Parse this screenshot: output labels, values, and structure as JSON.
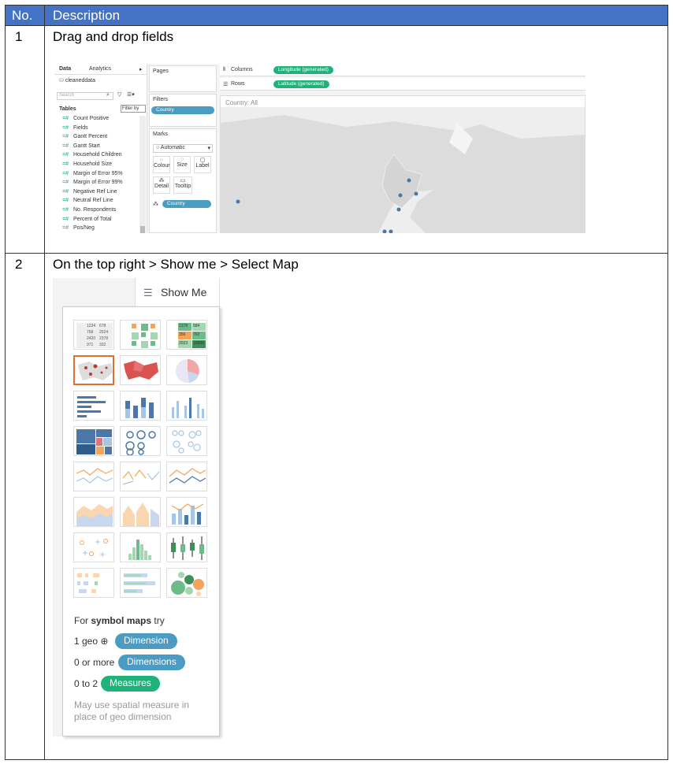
{
  "table": {
    "header_no": "No.",
    "header_desc": "Description",
    "rows": [
      {
        "no": "1",
        "desc": "Drag and drop fields"
      },
      {
        "no": "2",
        "desc": "On the top right > Show me > Select Map"
      }
    ]
  },
  "tableau": {
    "tab_data": "Data",
    "tab_analytics": "Analytics",
    "datasource": "cleaneddata",
    "search_placeholder": "Search",
    "filter_by": "Filter by",
    "tables_label": "Tables",
    "fields": [
      "Count Positive",
      "Fields",
      "Gantt Percent",
      "Gantt Start",
      "Household Children",
      "Household Size",
      "Margin of Error 95%",
      "Margin of Error 99%",
      "Negative Ref Line",
      "Neutral Ref Line",
      "No. Respondents",
      "Percent of Total",
      "Pos/Neg"
    ],
    "pages_label": "Pages",
    "filters_label": "Filters",
    "filter_pill": "Country",
    "marks_label": "Marks",
    "marks_type": "Automatic",
    "mark_colour": "Colour",
    "mark_size": "Size",
    "mark_label": "Label",
    "mark_detail": "Detail",
    "mark_tooltip": "Tooltip",
    "marks_pill": "Country",
    "columns_label": "Columns",
    "rows_label": "Rows",
    "columns_pill": "Longitude (generated)",
    "rows_pill": "Latitude (generated)",
    "map_title": "Country: All"
  },
  "showme": {
    "title": "Show Me",
    "hint_prefix": "For ",
    "hint_bold": "symbol maps",
    "hint_suffix": " try",
    "req1_prefix": "1 geo",
    "req1_pill": "Dimension",
    "req2_prefix": "0 or more",
    "req2_pill": "Dimensions",
    "req3_prefix": "0 to 2",
    "req3_pill": "Measures",
    "note": "May use spatial measure in place of geo dimension",
    "text_table_values": [
      "1234",
      "678",
      "768",
      "2024",
      "2420",
      "2378",
      "971",
      "332"
    ],
    "highlight_table_values": [
      "1378",
      "584",
      "356",
      "762",
      "2023",
      "10000"
    ]
  },
  "colors": {
    "header_blue": "#4472c4",
    "pill_blue": "#4b9cc3",
    "pill_green": "#1fb37a",
    "selected_orange": "#e07030"
  }
}
